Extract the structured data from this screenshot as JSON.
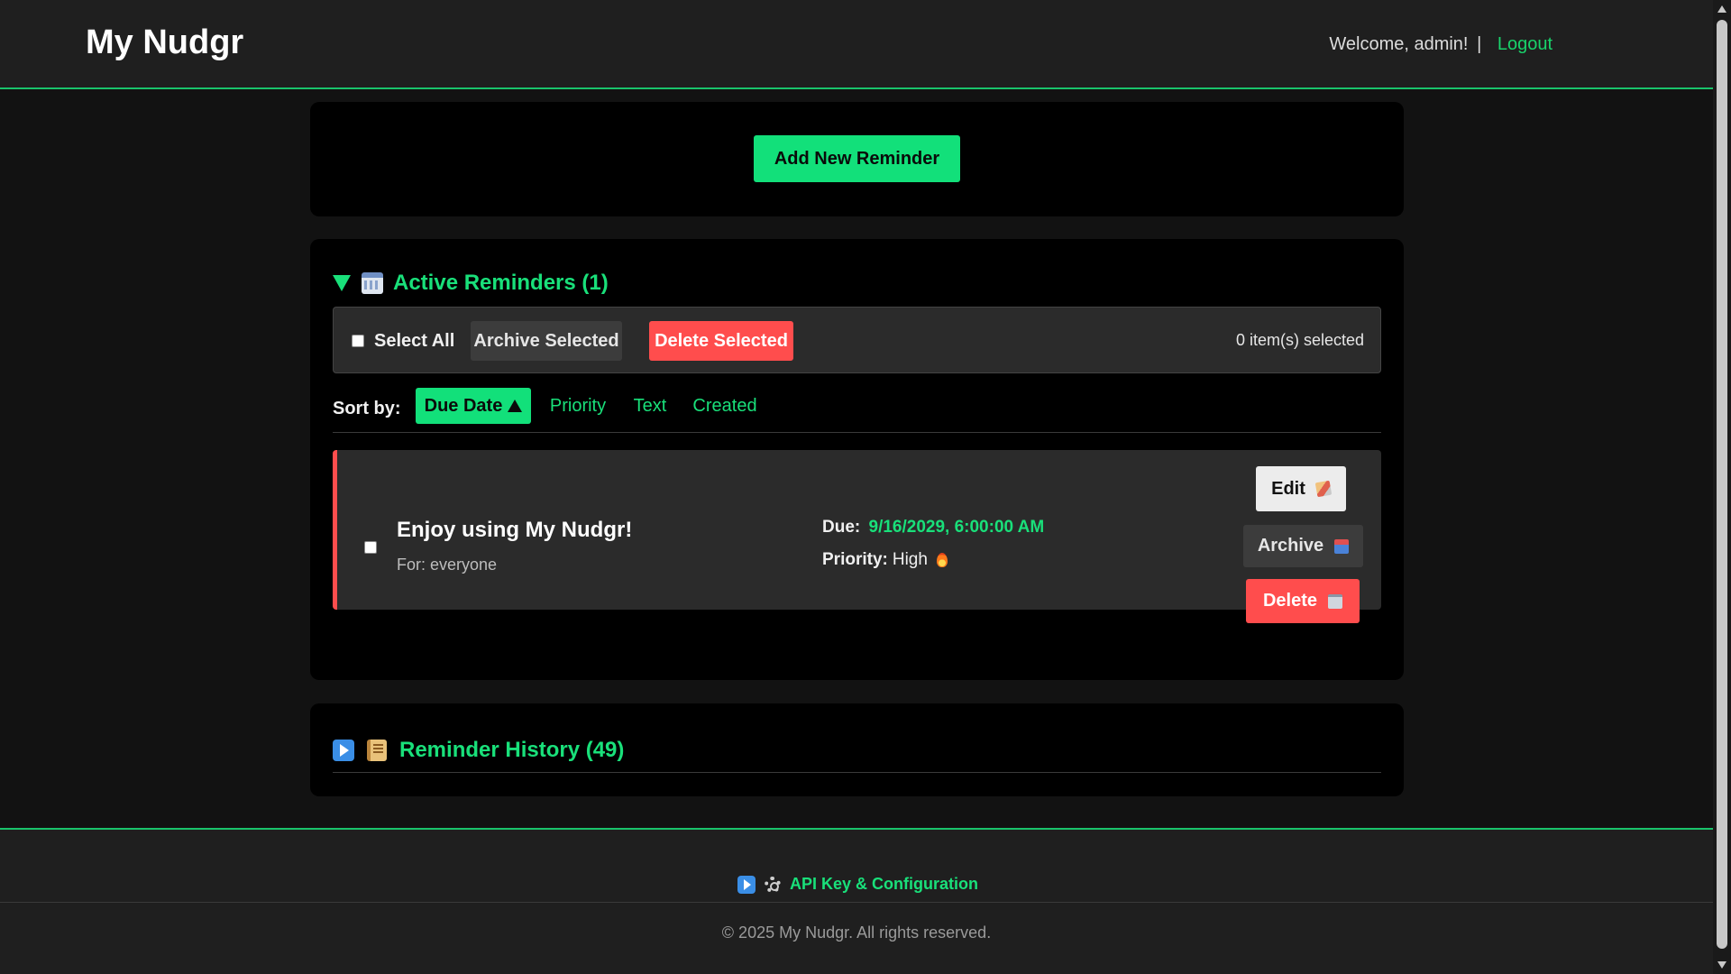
{
  "header": {
    "brand": "My Nudgr",
    "welcome": "Welcome, admin!",
    "separator": "|",
    "logout": "Logout"
  },
  "add": {
    "button_label": "Add New Reminder"
  },
  "active": {
    "title": "Active Reminders (1)",
    "bulk": {
      "select_all": "Select All",
      "archive_selected": "Archive Selected",
      "delete_selected": "Delete Selected",
      "selected_count": "0 item(s) selected"
    },
    "sort": {
      "label": "Sort by:",
      "options": [
        {
          "label": "Due Date",
          "active": true,
          "direction": "ascending"
        },
        {
          "label": "Priority",
          "active": false
        },
        {
          "label": "Text",
          "active": false
        },
        {
          "label": "Created",
          "active": false
        }
      ]
    },
    "reminders": [
      {
        "title": "Enjoy using My Nudgr!",
        "for": "For: everyone",
        "due_label": "Due:",
        "due_value": "9/16/2029, 6:00:00 AM",
        "priority_label": "Priority:",
        "priority_value": "High",
        "priority_icon": "fire-icon",
        "actions": {
          "edit": "Edit",
          "archive": "Archive",
          "delete": "Delete"
        }
      }
    ]
  },
  "history": {
    "title": "Reminder History (49)"
  },
  "footer": {
    "api_link": "API Key & Configuration",
    "copyright": "© 2025 My Nudgr. All rights reserved."
  },
  "colors": {
    "accent": "#12e07a",
    "danger": "#ff4d4d",
    "background": "#121212",
    "panel": "#000000"
  }
}
